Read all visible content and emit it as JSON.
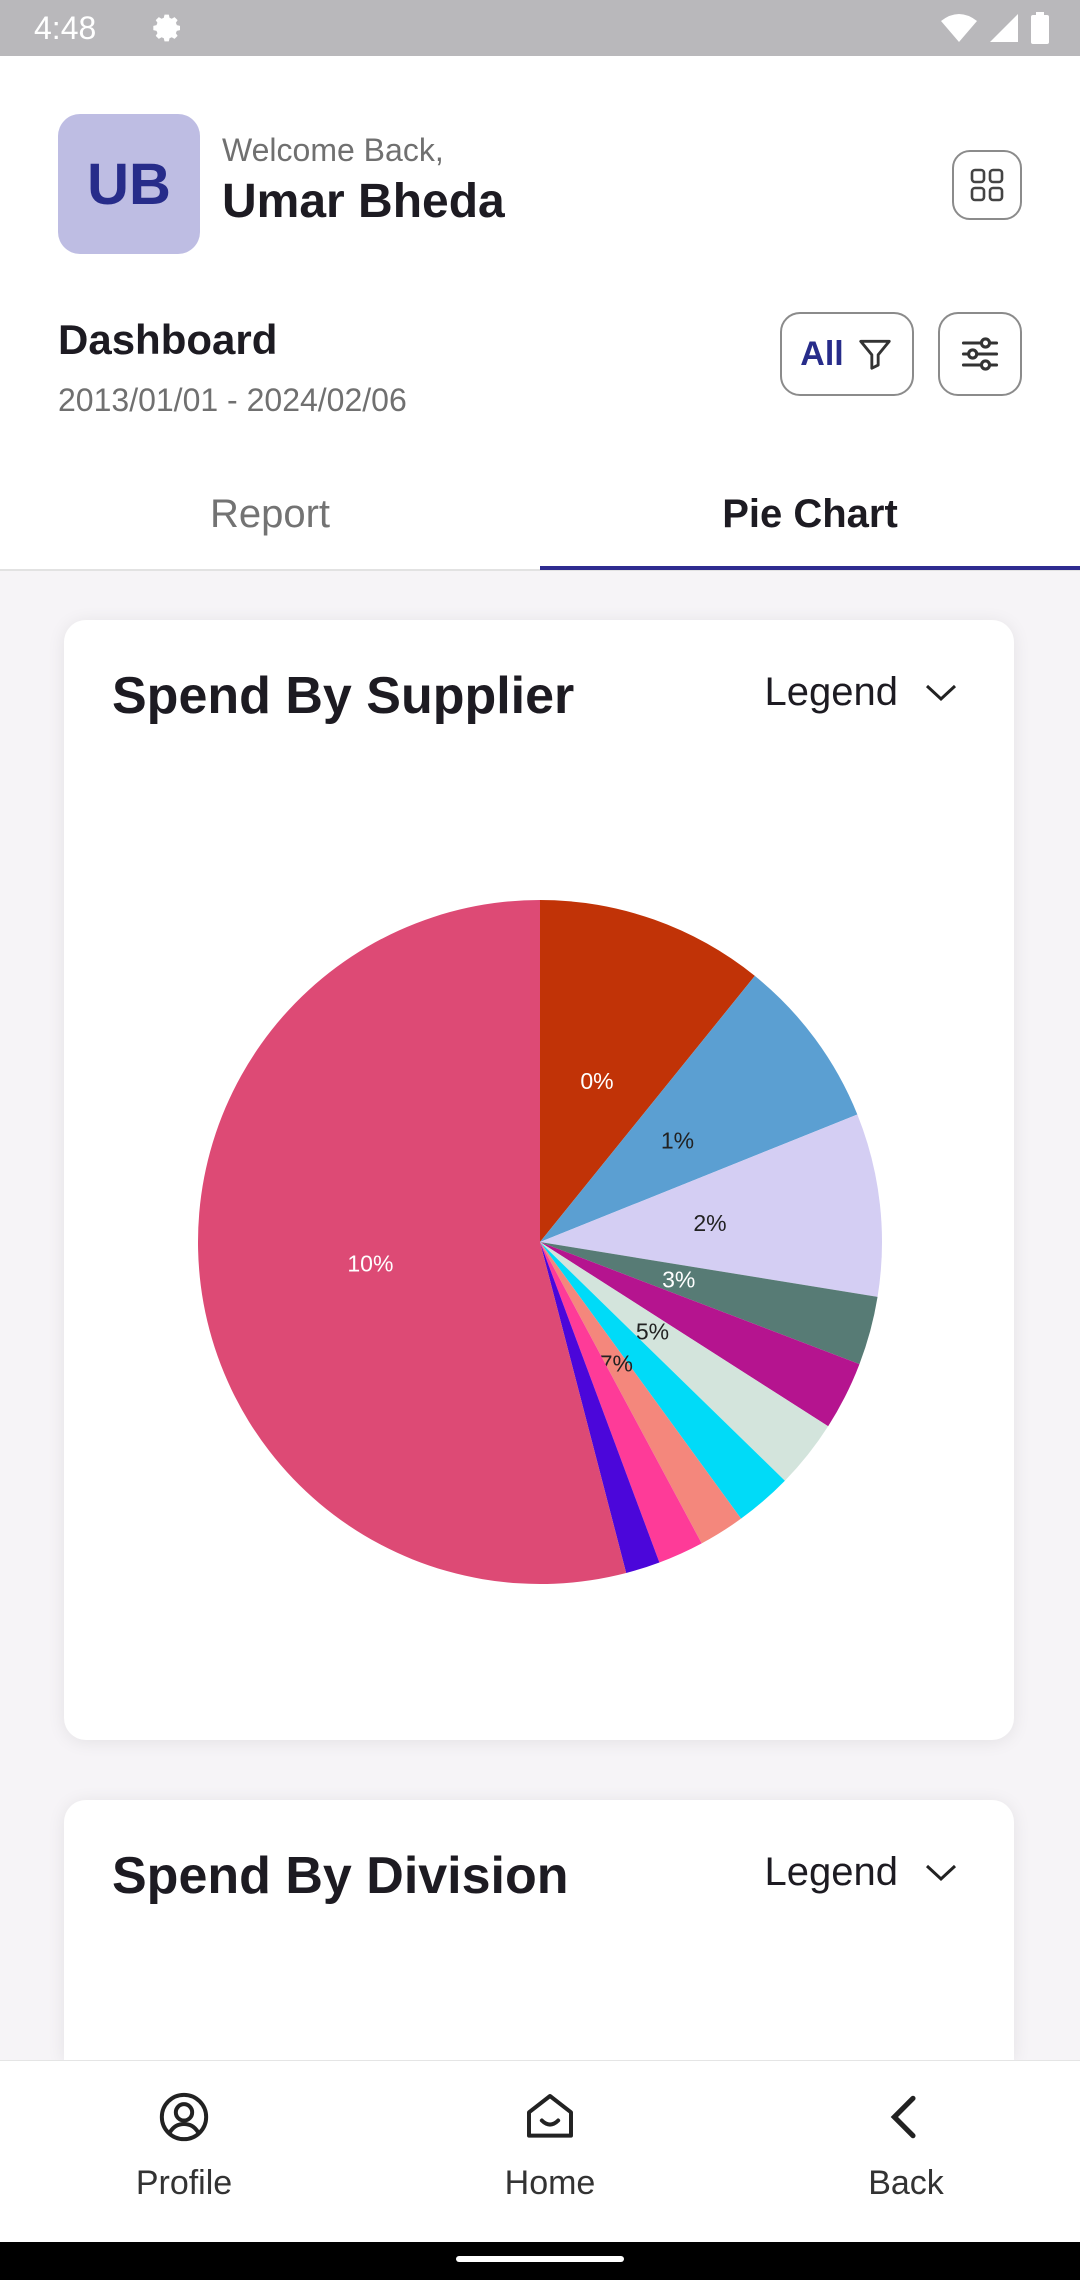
{
  "status_bar": {
    "time": "4:48"
  },
  "header": {
    "avatar_initials": "UB",
    "welcome_text": "Welcome Back,",
    "user_name": "Umar Bheda"
  },
  "dashboard": {
    "title": "Dashboard",
    "date_range": "2013/01/01 - 2024/02/06",
    "filter_label": "All"
  },
  "tabs": [
    {
      "label": "Report",
      "active": false
    },
    {
      "label": "Pie Chart",
      "active": true
    }
  ],
  "cards": [
    {
      "title": "Spend By Supplier",
      "legend_label": "Legend"
    },
    {
      "title": "Spend By Division",
      "legend_label": "Legend"
    }
  ],
  "chart_data": {
    "type": "pie",
    "title": "",
    "slices": [
      {
        "value": 10.0,
        "color": "#c13307",
        "label": "0%"
      },
      {
        "value": 7.5,
        "color": "#5b9fd2",
        "label": "1%"
      },
      {
        "value": 8.0,
        "color": "#d4cef3",
        "label": "2%"
      },
      {
        "value": 3.0,
        "color": "#577b75",
        "label": "3%"
      },
      {
        "value": 3.0,
        "color": "#b5148f",
        "label": ""
      },
      {
        "value": 3.0,
        "color": "#d3e4dc",
        "label": "5%"
      },
      {
        "value": 2.5,
        "color": "#00dbf8",
        "label": ""
      },
      {
        "value": 2.0,
        "color": "#f4877c",
        "label": "7%"
      },
      {
        "value": 2.0,
        "color": "#fe3b98",
        "label": ""
      },
      {
        "value": 1.5,
        "color": "#4b06da",
        "label": ""
      },
      {
        "value": 50.0,
        "color": "#dd4a75",
        "label": "10%"
      }
    ]
  },
  "bottom_nav": [
    {
      "label": "Profile"
    },
    {
      "label": "Home"
    },
    {
      "label": "Back"
    }
  ]
}
